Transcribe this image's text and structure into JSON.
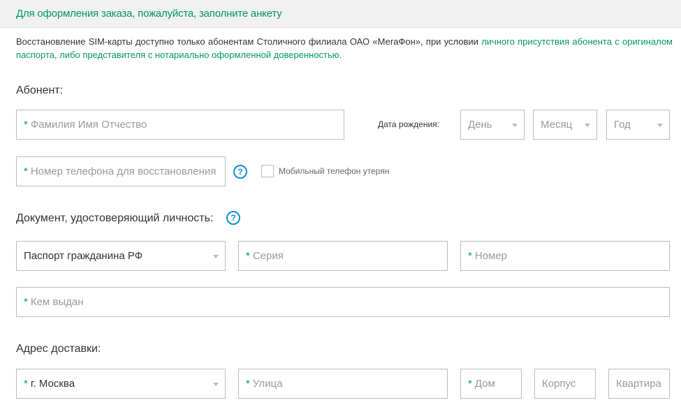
{
  "header": {
    "title": "Для оформления заказа, пожалуйста, заполните анкету"
  },
  "notice": {
    "text_before": "Восстановление SIM-карты доступно только абонентам Столичного филиала ОАО «МегаФон», при условии ",
    "text_highlight": "личного присутствия абонента с оригиналом паспорта, либо представителя с нотариально оформленной доверенностью",
    "text_after": "."
  },
  "subscriber": {
    "section_title": "Абонент:",
    "full_name_placeholder": "Фамилия Имя Отчество",
    "birth_date_label": "Дата рождения:",
    "day_placeholder": "День",
    "month_placeholder": "Месяц",
    "year_placeholder": "Год",
    "phone_placeholder": "Номер телефона для восстановления",
    "help_glyph": "?",
    "phone_lost_label": "Мобильный телефон утерян"
  },
  "document": {
    "section_title": "Документ, удостоверяющий личность:",
    "help_glyph": "?",
    "type_value": "Паспорт гражданина РФ",
    "series_placeholder": "Серия",
    "number_placeholder": "Номер",
    "issued_by_placeholder": "Кем выдан"
  },
  "delivery": {
    "section_title": "Адрес доставки:",
    "city_value": "г. Москва",
    "street_placeholder": "Улица",
    "house_placeholder": "Дом",
    "building_placeholder": "Корпус",
    "apartment_placeholder": "Квартира"
  },
  "required_marker": "*",
  "colors": {
    "accent_green": "#00985f",
    "help_blue": "#0f8fd4",
    "border": "#bdbdbd",
    "header_bg": "#f1f1f1"
  }
}
